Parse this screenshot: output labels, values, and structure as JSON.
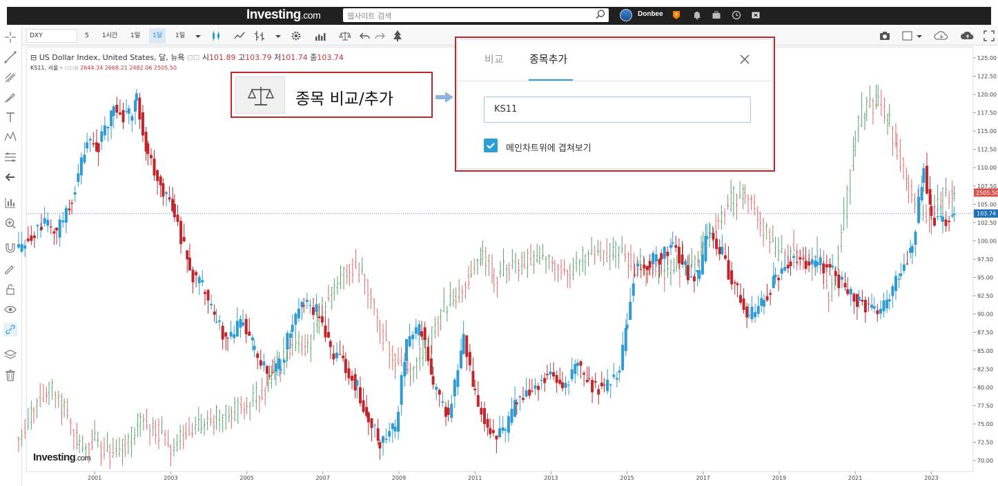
{
  "topbar": {
    "logo_main": "Investing",
    "logo_suffix": ".com",
    "search_placeholder": "웹사이트 검색",
    "username": "Donbee"
  },
  "toolbar": {
    "symbol": "DXY",
    "intervals": [
      "5",
      "1시간",
      "1일",
      "1달",
      "1일"
    ],
    "active_interval_index": 3
  },
  "legend": {
    "main": {
      "name": "US Dollar Index, United States, 달, 뉴욕",
      "open_label": "시",
      "open": "101.89",
      "high_label": "고",
      "high": "103.79",
      "low_label": "저",
      "low": "101.74",
      "close_label": "종",
      "close": "103.74"
    },
    "compare": {
      "name": "KS11, 서울",
      "values": "2644.34  2668.21  2482.06  2505.50"
    }
  },
  "callout": {
    "label": "종목 비교/추가"
  },
  "dialog": {
    "tab_compare": "비교",
    "tab_add": "종목추가",
    "symbol_value": "KS11",
    "overlay_label": "메인차트위에 겹쳐보기",
    "overlay_checked": true
  },
  "colors": {
    "up": "#2f9bd3",
    "down": "#c0272d",
    "ks_up": "#5aa06a",
    "ks_down": "#e06666",
    "accent": "#2a9fd6",
    "highlight": "#c0272d"
  },
  "chart_data": {
    "type": "candlestick",
    "watermark": "Investing.com",
    "y_ticks": [
      "125.00",
      "122.50",
      "120.00",
      "117.50",
      "115.00",
      "112.50",
      "110.00",
      "107.50",
      "105.00",
      "102.50",
      "100.00",
      "97.50",
      "95.00",
      "92.50",
      "90.00",
      "87.50",
      "85.00",
      "82.50",
      "80.00",
      "77.50",
      "75.00",
      "72.50",
      "70.00"
    ],
    "x_ticks": [
      "2001",
      "2003",
      "2005",
      "2007",
      "2009",
      "2011",
      "2013",
      "2015",
      "2017",
      "2019",
      "2021",
      "2023"
    ],
    "ylim": [
      68.5,
      126.5
    ],
    "xlim": [
      1999.2,
      2024.1
    ],
    "last_price_label": "103.74",
    "compare_price_label": "2505.50",
    "series": [
      {
        "name": "US Dollar Index",
        "style": "candle",
        "points": [
          [
            1999.0,
            99.0
          ],
          [
            1999.6,
            102.5
          ],
          [
            2000.0,
            101.0
          ],
          [
            2000.4,
            106.0
          ],
          [
            2000.8,
            113.5
          ],
          [
            2001.1,
            113.0
          ],
          [
            2001.5,
            118.0
          ],
          [
            2001.9,
            117.0
          ],
          [
            2002.1,
            119.5
          ],
          [
            2002.4,
            112.0
          ],
          [
            2002.8,
            107.0
          ],
          [
            2003.1,
            104.0
          ],
          [
            2003.5,
            96.0
          ],
          [
            2003.9,
            93.0
          ],
          [
            2004.2,
            88.5
          ],
          [
            2004.5,
            86.5
          ],
          [
            2004.9,
            89.0
          ],
          [
            2005.2,
            85.0
          ],
          [
            2005.6,
            81.5
          ],
          [
            2005.9,
            83.0
          ],
          [
            2006.2,
            89.0
          ],
          [
            2006.5,
            91.5
          ],
          [
            2006.9,
            90.0
          ],
          [
            2007.2,
            85.0
          ],
          [
            2007.6,
            83.0
          ],
          [
            2007.9,
            80.0
          ],
          [
            2008.2,
            75.5
          ],
          [
            2008.5,
            72.5
          ],
          [
            2008.9,
            74.5
          ],
          [
            2009.2,
            86.0
          ],
          [
            2009.6,
            88.0
          ],
          [
            2009.9,
            80.0
          ],
          [
            2010.3,
            76.0
          ],
          [
            2010.7,
            86.5
          ],
          [
            2011.0,
            78.5
          ],
          [
            2011.4,
            74.0
          ],
          [
            2011.8,
            73.5
          ],
          [
            2012.1,
            78.5
          ],
          [
            2012.5,
            80.0
          ],
          [
            2012.9,
            82.0
          ],
          [
            2013.3,
            80.0
          ],
          [
            2013.7,
            83.0
          ],
          [
            2014.0,
            80.5
          ],
          [
            2014.4,
            80.0
          ],
          [
            2014.8,
            82.5
          ],
          [
            2015.0,
            89.0
          ],
          [
            2015.2,
            96.0
          ],
          [
            2015.6,
            97.0
          ],
          [
            2015.9,
            98.0
          ],
          [
            2016.2,
            99.5
          ],
          [
            2016.6,
            95.5
          ],
          [
            2016.9,
            95.0
          ],
          [
            2017.1,
            101.5
          ],
          [
            2017.5,
            98.0
          ],
          [
            2017.9,
            93.0
          ],
          [
            2018.2,
            89.5
          ],
          [
            2018.6,
            92.0
          ],
          [
            2018.9,
            95.0
          ],
          [
            2019.3,
            97.5
          ],
          [
            2019.7,
            97.0
          ],
          [
            2020.0,
            97.0
          ],
          [
            2020.4,
            96.0
          ],
          [
            2020.8,
            93.0
          ],
          [
            2021.1,
            92.0
          ],
          [
            2021.5,
            90.0
          ],
          [
            2021.9,
            92.0
          ],
          [
            2022.2,
            96.0
          ],
          [
            2022.5,
            99.5
          ],
          [
            2022.8,
            110.0
          ],
          [
            2023.0,
            103.0
          ],
          [
            2023.3,
            102.5
          ],
          [
            2023.6,
            103.74
          ]
        ]
      },
      {
        "name": "KS11",
        "style": "bar",
        "points": [
          [
            1999.0,
            73.0
          ],
          [
            1999.4,
            77.5
          ],
          [
            1999.8,
            80.0
          ],
          [
            2000.2,
            77.0
          ],
          [
            2000.6,
            71.5
          ],
          [
            2001.0,
            72.5
          ],
          [
            2001.4,
            71.0
          ],
          [
            2001.8,
            72.0
          ],
          [
            2002.2,
            76.0
          ],
          [
            2002.6,
            74.5
          ],
          [
            2003.0,
            72.0
          ],
          [
            2003.4,
            73.5
          ],
          [
            2003.8,
            74.5
          ],
          [
            2004.2,
            76.0
          ],
          [
            2004.6,
            76.5
          ],
          [
            2005.0,
            78.0
          ],
          [
            2005.4,
            79.5
          ],
          [
            2005.8,
            83.0
          ],
          [
            2006.2,
            86.0
          ],
          [
            2006.6,
            85.5
          ],
          [
            2006.9,
            90.0
          ],
          [
            2007.3,
            94.0
          ],
          [
            2007.7,
            97.0
          ],
          [
            2008.1,
            94.5
          ],
          [
            2008.5,
            88.0
          ],
          [
            2008.9,
            84.0
          ],
          [
            2009.3,
            82.0
          ],
          [
            2009.7,
            86.0
          ],
          [
            2010.1,
            90.0
          ],
          [
            2010.5,
            92.5
          ],
          [
            2010.9,
            96.0
          ],
          [
            2011.2,
            99.0
          ],
          [
            2011.5,
            95.0
          ],
          [
            2011.9,
            96.5
          ],
          [
            2012.3,
            97.0
          ],
          [
            2012.7,
            97.5
          ],
          [
            2013.1,
            97.0
          ],
          [
            2013.5,
            96.0
          ],
          [
            2013.9,
            98.0
          ],
          [
            2014.3,
            98.0
          ],
          [
            2014.7,
            98.5
          ],
          [
            2015.1,
            97.5
          ],
          [
            2015.5,
            96.5
          ],
          [
            2015.9,
            96.0
          ],
          [
            2016.3,
            96.0
          ],
          [
            2016.7,
            97.0
          ],
          [
            2017.0,
            99.0
          ],
          [
            2017.4,
            103.0
          ],
          [
            2017.8,
            106.0
          ],
          [
            2018.1,
            106.5
          ],
          [
            2018.5,
            103.0
          ],
          [
            2018.9,
            98.0
          ],
          [
            2019.3,
            99.0
          ],
          [
            2019.7,
            97.0
          ],
          [
            2020.0,
            98.0
          ],
          [
            2020.3,
            92.0
          ],
          [
            2020.7,
            103.0
          ],
          [
            2021.0,
            115.0
          ],
          [
            2021.3,
            119.0
          ],
          [
            2021.6,
            118.5
          ],
          [
            2021.9,
            116.0
          ],
          [
            2022.1,
            112.0
          ],
          [
            2022.4,
            107.0
          ],
          [
            2022.7,
            104.0
          ],
          [
            2023.0,
            103.5
          ],
          [
            2023.3,
            106.0
          ],
          [
            2023.6,
            106.5
          ]
        ]
      }
    ]
  }
}
